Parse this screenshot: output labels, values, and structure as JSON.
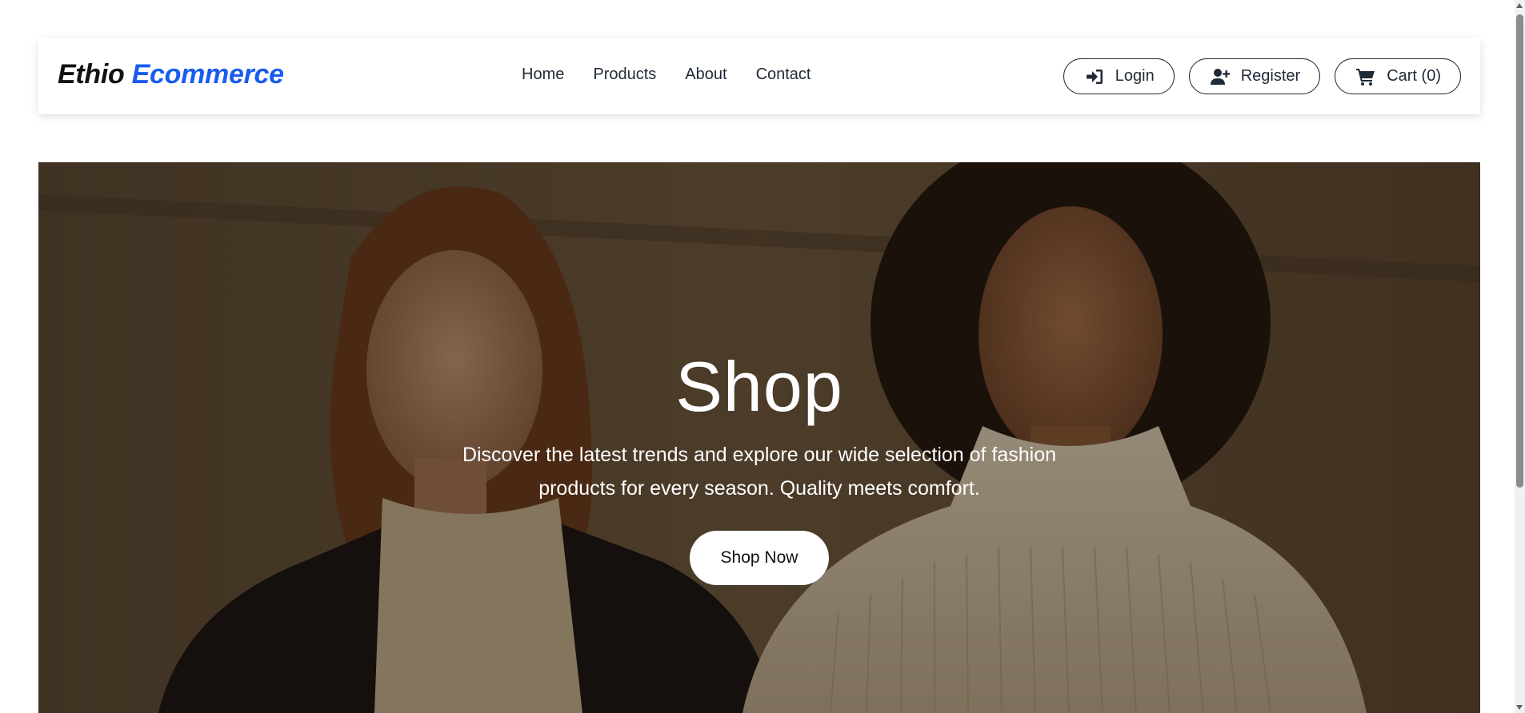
{
  "brand": {
    "part1": "Ethio",
    "part2": "Ecommerce"
  },
  "nav": {
    "links": [
      {
        "label": "Home"
      },
      {
        "label": "Products"
      },
      {
        "label": "About"
      },
      {
        "label": "Contact"
      }
    ],
    "actions": {
      "login_label": "Login",
      "register_label": "Register",
      "cart_label": "Cart (0)"
    }
  },
  "hero": {
    "title": "Shop",
    "description": "Discover the latest trends and explore our wide selection of fashion products for every season. Quality meets comfort.",
    "button_label": "Shop Now"
  },
  "icons": {
    "login": "sign-in-icon",
    "register": "user-plus-icon",
    "cart": "shopping-cart-icon"
  },
  "colors": {
    "brand_accent": "#1a5cf0",
    "text_dark": "#1f2a37",
    "hero_button_bg": "#ffffff"
  }
}
